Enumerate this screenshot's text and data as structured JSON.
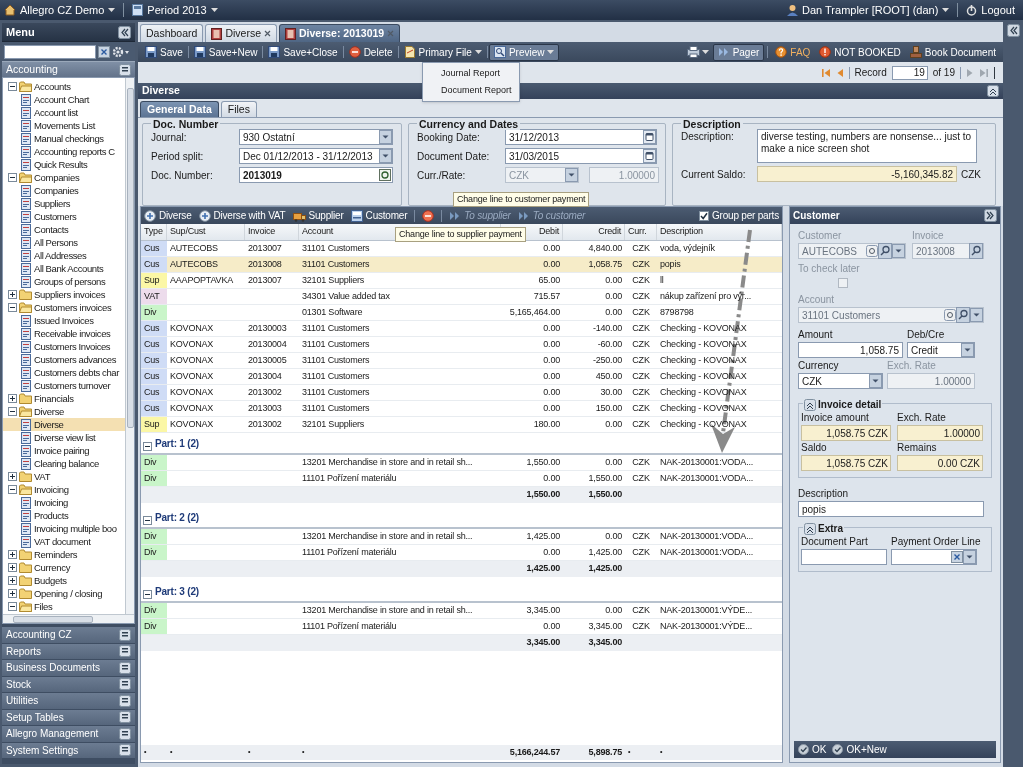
{
  "top_bar": {
    "app": "Allegro CZ Demo",
    "period": "Period 2013",
    "user": "Dan Trampler [ROOT] (dan)",
    "logout": "Logout"
  },
  "sidebar": {
    "title": "Menu",
    "section": "Accounting",
    "tree": [
      {
        "label": "Accounts",
        "expanded": true,
        "children": [
          {
            "label": "Account Chart",
            "selected": false
          },
          {
            "label": "Account list",
            "selected": false
          },
          {
            "label": "Movements List",
            "selected": false
          },
          {
            "label": "Manual checkings",
            "selected": false
          },
          {
            "label": "Accounting reports C",
            "selected": false
          },
          {
            "label": "Quick Results",
            "selected": false
          }
        ]
      },
      {
        "label": "Companies",
        "expanded": true,
        "children": [
          {
            "label": "Companies",
            "selected": false
          },
          {
            "label": "Suppliers",
            "selected": false
          },
          {
            "label": "Customers",
            "selected": false
          },
          {
            "label": "Contacts",
            "selected": false
          },
          {
            "label": "All Persons",
            "selected": false
          },
          {
            "label": "All Addresses",
            "selected": false
          },
          {
            "label": "All Bank Accounts",
            "selected": false
          },
          {
            "label": "Groups of persons",
            "selected": false
          }
        ]
      },
      {
        "label": "Suppliers invoices",
        "expanded": false
      },
      {
        "label": "Customers invoices",
        "expanded": true,
        "children": [
          {
            "label": "Issued Invoices",
            "selected": false
          },
          {
            "label": "Receivable invoices",
            "selected": false
          },
          {
            "label": "Customers Invoices",
            "selected": false
          },
          {
            "label": "Customers advances",
            "selected": false
          },
          {
            "label": "Customers debts char",
            "selected": false
          },
          {
            "label": "Customers turnover",
            "selected": false
          }
        ]
      },
      {
        "label": "Financials",
        "expanded": false
      },
      {
        "label": "Diverse",
        "expanded": true,
        "children": [
          {
            "label": "Diverse",
            "selected": true
          },
          {
            "label": "Diverse view list",
            "selected": false
          },
          {
            "label": "Invoice pairing",
            "selected": false
          },
          {
            "label": "Clearing balance",
            "selected": false
          }
        ]
      },
      {
        "label": "VAT",
        "expanded": false
      },
      {
        "label": "Invoicing",
        "expanded": true,
        "children": [
          {
            "label": "Invoicing",
            "selected": false
          },
          {
            "label": "Products",
            "selected": false
          },
          {
            "label": "Invoicing multiple boo",
            "selected": false
          },
          {
            "label": "VAT document",
            "selected": false
          }
        ]
      },
      {
        "label": "Reminders",
        "expanded": false
      },
      {
        "label": "Currency",
        "expanded": false
      },
      {
        "label": "Budgets",
        "expanded": false
      },
      {
        "label": "Opening / closing",
        "expanded": false
      },
      {
        "label": "Files",
        "expanded": true
      }
    ],
    "panels": [
      "Accounting CZ",
      "Reports",
      "Business Documents",
      "Stock",
      "Utilities",
      "Setup Tables",
      "Allegro Management",
      "System Settings"
    ]
  },
  "tabs": [
    {
      "label": "Dashboard",
      "selected": false,
      "closable": false
    },
    {
      "label": "Diverse",
      "selected": false,
      "closable": true
    },
    {
      "label": "Diverse: 2013019",
      "selected": true,
      "closable": true
    }
  ],
  "toolbar": {
    "left": [
      {
        "label": "Save",
        "dropdown": false,
        "pressed": false
      },
      {
        "label": "Save+New",
        "dropdown": false,
        "pressed": false
      },
      {
        "label": "Save+Close",
        "dropdown": false,
        "pressed": false
      },
      {
        "label": "Delete",
        "dropdown": false,
        "pressed": false
      },
      {
        "label": "Primary File",
        "dropdown": true,
        "pressed": false
      },
      {
        "label": "Preview",
        "dropdown": true,
        "pressed": true
      }
    ],
    "right": [
      {
        "label": "Pager",
        "kind": "toggle",
        "pressed": true
      },
      {
        "label": "FAQ",
        "kind": "link",
        "pressed": false
      },
      {
        "label": "NOT BOOKED",
        "kind": "status",
        "pressed": false
      },
      {
        "label": "Book Document",
        "kind": "button",
        "pressed": false
      }
    ]
  },
  "preview_menu": [
    "Journal Report",
    "Document Report"
  ],
  "pager": {
    "label": "Record",
    "value": "19",
    "total": "of 19"
  },
  "panel_title": "Diverse",
  "form_tabs": [
    {
      "label": "General Data",
      "selected": true
    },
    {
      "label": "Files",
      "selected": false
    }
  ],
  "groups": [
    {
      "title": "Doc. Number",
      "fields": [
        {
          "label": "Journal:",
          "kind": "combo",
          "value": "930 Ostatní"
        },
        {
          "label": "Period split:",
          "kind": "combo",
          "value": "Dec 01/12/2013 - 31/12/2013"
        },
        {
          "label": "Doc. Number:",
          "kind": "docnumber",
          "value": "2013019"
        }
      ]
    },
    {
      "title": "Currency and Dates",
      "fields": [
        {
          "label": "Booking Date:",
          "kind": "date",
          "value": "31/12/2013"
        },
        {
          "label": "Document Date:",
          "kind": "date",
          "value": "31/03/2015"
        },
        {
          "label": "Curr./Rate:",
          "kind": "rate",
          "value": "CZK",
          "rate": "1.00000"
        }
      ]
    },
    {
      "title": "Description",
      "fields": [
        {
          "label": "Description:",
          "kind": "memo",
          "value": "diverse testing, numbers are nonsense... just to make a nice screen shot"
        },
        {
          "label": "Current Saldo:",
          "kind": "saldo",
          "value": "-5,160,345.82",
          "unit": "CZK"
        }
      ]
    }
  ],
  "grid": {
    "toolbar": [
      {
        "label": "Diverse",
        "kind": "add",
        "disabled": false
      },
      {
        "label": "Diverse with VAT",
        "kind": "add",
        "disabled": false
      },
      {
        "label": "Supplier",
        "kind": "supplier",
        "disabled": false
      },
      {
        "label": "Customer",
        "kind": "customer",
        "disabled": false
      },
      {
        "kind": "remove",
        "disabled": false
      },
      {
        "label": "To supplier",
        "kind": "move",
        "disabled": true
      },
      {
        "label": "To customer",
        "kind": "move",
        "disabled": true
      }
    ],
    "group_per_parts": {
      "label": "Group per parts",
      "checked": true
    },
    "tooltips": [
      "Change line to customer payment",
      "Change line to supplier payment"
    ],
    "columns": [
      "Type",
      "Sup/Cust",
      "Invoice",
      "Account",
      "Debit",
      "Credit",
      "Curr.",
      "Description"
    ],
    "rows": [
      {
        "type": "Cus",
        "color": "#cfdcf6",
        "sup_cust": "AUTECOBS",
        "invoice": "2013007",
        "account": "31101 Customers",
        "debit": "0.00",
        "credit": "4,840.00",
        "curr": "CZK",
        "description": "voda, výdejník",
        "selected": false
      },
      {
        "type": "Cus",
        "color": "#cfdcf6",
        "sup_cust": "AUTECOBS",
        "invoice": "2013008",
        "account": "31101 Customers",
        "debit": "0.00",
        "credit": "1,058.75",
        "curr": "CZK",
        "description": "popis",
        "selected": true
      },
      {
        "type": "Sup",
        "color": "#fbf7a6",
        "sup_cust": "AAAPOPTAVKA",
        "invoice": "2013007",
        "account": "32101 Suppliers",
        "debit": "65.00",
        "credit": "0.00",
        "curr": "CZK",
        "description": "ll",
        "selected": false
      },
      {
        "type": "VAT",
        "color": "#eddcec",
        "account": "34301 Value added tax",
        "debit": "715.57",
        "credit": "0.00",
        "curr": "CZK",
        "description": "nákup zařízení pro výr...",
        "selected": false
      },
      {
        "type": "Div",
        "color": "#c9f5c9",
        "account": "01301 Software",
        "debit": "5,165,464.00",
        "credit": "0.00",
        "curr": "CZK",
        "description": "8798798",
        "selected": false
      },
      {
        "type": "Cus",
        "color": "#cfdcf6",
        "sup_cust": "KOVONAX",
        "invoice": "20130003",
        "account": "31101 Customers",
        "debit": "0.00",
        "credit": "-140.00",
        "curr": "CZK",
        "description": "Checking - KOVONAX",
        "selected": false
      },
      {
        "type": "Cus",
        "color": "#cfdcf6",
        "sup_cust": "KOVONAX",
        "invoice": "20130004",
        "account": "31101 Customers",
        "debit": "0.00",
        "credit": "-60.00",
        "curr": "CZK",
        "description": "Checking - KOVONAX",
        "selected": false
      },
      {
        "type": "Cus",
        "color": "#cfdcf6",
        "sup_cust": "KOVONAX",
        "invoice": "20130005",
        "account": "31101 Customers",
        "debit": "0.00",
        "credit": "-250.00",
        "curr": "CZK",
        "description": "Checking - KOVONAX",
        "selected": false
      },
      {
        "type": "Cus",
        "color": "#cfdcf6",
        "sup_cust": "KOVONAX",
        "invoice": "2013004",
        "account": "31101 Customers",
        "debit": "0.00",
        "credit": "450.00",
        "curr": "CZK",
        "description": "Checking - KOVONAX",
        "selected": false
      },
      {
        "type": "Cus",
        "color": "#cfdcf6",
        "sup_cust": "KOVONAX",
        "invoice": "2013002",
        "account": "31101 Customers",
        "debit": "0.00",
        "credit": "30.00",
        "curr": "CZK",
        "description": "Checking - KOVONAX",
        "selected": false
      },
      {
        "type": "Cus",
        "color": "#cfdcf6",
        "sup_cust": "KOVONAX",
        "invoice": "2013003",
        "account": "31101 Customers",
        "debit": "0.00",
        "credit": "150.00",
        "curr": "CZK",
        "description": "Checking - KOVONAX",
        "selected": false
      },
      {
        "type": "Sup",
        "color": "#fbf7a6",
        "sup_cust": "KOVONAX",
        "invoice": "2013002",
        "account": "32101 Suppliers",
        "debit": "180.00",
        "credit": "0.00",
        "curr": "CZK",
        "description": "Checking - KOVONAX",
        "selected": false
      }
    ],
    "parts": [
      {
        "title": "Part: 1 (2)",
        "expanded": true,
        "total_debit": "1,550.00",
        "total_credit": "1,550.00",
        "rows": [
          {
            "type": "Div",
            "color": "#c9f5c9",
            "account": "13201 Merchandise in store and in retail sh...",
            "debit": "1,550.00",
            "credit": "0.00",
            "curr": "CZK",
            "description": "NAK-20130001:VODA...",
            "selected": false
          },
          {
            "type": "Div",
            "color": "#c9f5c9",
            "account": "11101 Pořízení materiálu",
            "debit": "0.00",
            "credit": "1,550.00",
            "curr": "CZK",
            "description": "NAK-20130001:VODA...",
            "selected": false
          }
        ]
      },
      {
        "title": "Part: 2 (2)",
        "expanded": true,
        "total_debit": "1,425.00",
        "total_credit": "1,425.00",
        "rows": [
          {
            "type": "Div",
            "color": "#c9f5c9",
            "account": "13201 Merchandise in store and in retail sh...",
            "debit": "1,425.00",
            "credit": "0.00",
            "curr": "CZK",
            "description": "NAK-20130001:VODA...",
            "selected": false
          },
          {
            "type": "Div",
            "color": "#c9f5c9",
            "account": "11101 Pořízení materiálu",
            "debit": "0.00",
            "credit": "1,425.00",
            "curr": "CZK",
            "description": "NAK-20130001:VODA...",
            "selected": false
          }
        ]
      },
      {
        "title": "Part: 3 (2)",
        "expanded": true,
        "total_debit": "3,345.00",
        "total_credit": "3,345.00",
        "rows": [
          {
            "type": "Div",
            "color": "#c9f5c9",
            "account": "13201 Merchandise in store and in retail sh...",
            "debit": "3,345.00",
            "credit": "0.00",
            "curr": "CZK",
            "description": "NAK-20130001:VÝDE...",
            "selected": false
          },
          {
            "type": "Div",
            "color": "#c9f5c9",
            "account": "11101 Pořízení materiálu",
            "debit": "0.00",
            "credit": "3,345.00",
            "curr": "CZK",
            "description": "NAK-20130001:VÝDE...",
            "selected": false
          }
        ]
      }
    ],
    "footer": [
      "•",
      "•",
      "•",
      "•",
      "5,166,244.57",
      "5,898.75",
      "•",
      "•"
    ]
  },
  "detail": {
    "title": "Customer",
    "customer": {
      "label": "Customer",
      "value": "AUTECOBS"
    },
    "invoice": {
      "label": "Invoice",
      "value": "2013008"
    },
    "to_check_later": {
      "label": "To check later",
      "checked": false
    },
    "account": {
      "label": "Account",
      "value": "31101 Customers"
    },
    "amount": {
      "label": "Amount",
      "value": "1,058.75"
    },
    "deb_cre": {
      "label": "Deb/Cre",
      "value": "Credit"
    },
    "currency": {
      "label": "Currency",
      "value": "CZK"
    },
    "exch_rate": {
      "label": "Exch. Rate",
      "value": "1.00000"
    },
    "invoice_detail": {
      "title": "Invoice detail",
      "expanded": true,
      "fields": [
        {
          "label": "Invoice amount",
          "value": "1,058.75 CZK"
        },
        {
          "label": "Exch. Rate",
          "value": "1.00000"
        },
        {
          "label": "Saldo",
          "value": "1,058.75 CZK"
        },
        {
          "label": "Remains",
          "value": "0.00 CZK"
        }
      ]
    },
    "description": {
      "label": "Description",
      "value": "popis"
    },
    "extra": {
      "title": "Extra",
      "expanded": true,
      "fields": [
        {
          "label": "Document Part",
          "kind": "text"
        },
        {
          "label": "Payment Order Line",
          "kind": "combo"
        }
      ]
    },
    "buttons": [
      "OK",
      "OK+New"
    ]
  }
}
